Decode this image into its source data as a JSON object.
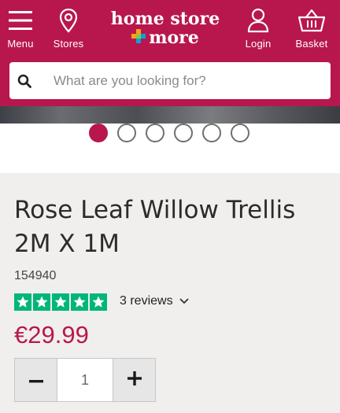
{
  "header": {
    "nav": {
      "menu_label": "Menu",
      "stores_label": "Stores",
      "login_label": "Login",
      "basket_label": "Basket"
    },
    "logo": {
      "line1": "home store",
      "line2": "more"
    },
    "brand_color": "#b8174e"
  },
  "search": {
    "placeholder": "What are you looking for?",
    "value": ""
  },
  "carousel": {
    "slide_count": 6,
    "active_index": 0
  },
  "product": {
    "title": "Rose Leaf Willow Trellis 2M X 1M",
    "sku": "154940",
    "rating": {
      "stars": 5,
      "reviews_label": "3 reviews"
    },
    "price": "€29.99",
    "quantity": {
      "value": "1",
      "decrement_icon": "minus-icon",
      "increment_icon": "plus-icon"
    }
  }
}
